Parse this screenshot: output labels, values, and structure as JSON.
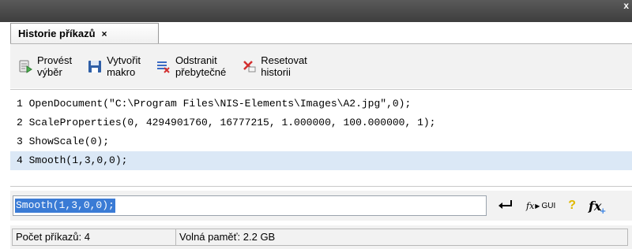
{
  "window": {
    "close_glyph": "x"
  },
  "tab": {
    "title": "Historie příkazů",
    "close_glyph": "×"
  },
  "toolbar": {
    "run_selection": {
      "line1": "Provést",
      "line2": "výběr",
      "icon": "play-script-icon"
    },
    "create_macro": {
      "line1": "Vytvořit",
      "line2": "makro",
      "icon": "save-floppy-icon"
    },
    "remove_redundant": {
      "line1": "Odstranit",
      "line2": "přebytečné",
      "icon": "remove-lines-icon"
    },
    "reset_history": {
      "line1": "Resetovat",
      "line2": "historii",
      "icon": "reset-x-icon"
    }
  },
  "history": {
    "lines": [
      "1 OpenDocument(\"C:\\Program Files\\NIS-Elements\\Images\\A2.jpg\",0);",
      "2 ScaleProperties(0, 4294901760, 16777215, 1.000000, 100.000000, 1);",
      "3 ShowScale(0);",
      "4 Smooth(1,3,0,0);"
    ],
    "selected_index": 3
  },
  "command": {
    "value": "Smooth(1,3,0,0);",
    "execute_icon": "enter-arrow-icon",
    "fx_gui_label": "fx",
    "gui_label": "GUI",
    "help_glyph": "?",
    "insert_function_label": "fx"
  },
  "status": {
    "command_count": "Počet příkazů: 4",
    "free_memory": "Volná paměť: 2.2 GB"
  },
  "colors": {
    "selection": "#dbe8f6",
    "input_highlight": "#3a7bd5"
  }
}
